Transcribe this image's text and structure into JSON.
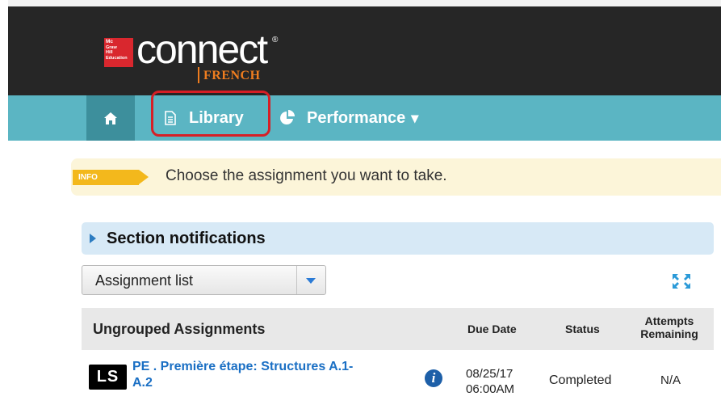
{
  "header": {
    "publisher_logo_lines": [
      "Mc",
      "Graw",
      "Hill",
      "Education"
    ],
    "brand": "connect",
    "brand_mark": "®",
    "subject": "FRENCH"
  },
  "nav": {
    "home_icon": "home-icon",
    "library_icon": "document-icon",
    "library_label": "Library",
    "performance_icon": "pie-chart-icon",
    "performance_label": "Performance",
    "performance_caret": "▾",
    "highlight_color": "#d61f26"
  },
  "info": {
    "badge": "INFO",
    "message": "Choose the assignment you want to take."
  },
  "notifications": {
    "title": "Section notifications"
  },
  "view_select": {
    "selected": "Assignment list"
  },
  "table": {
    "group_title": "Ungrouped Assignments",
    "columns": {
      "due": "Due Date",
      "status": "Status",
      "attempts_line1": "Attempts",
      "attempts_line2": "Remaining"
    },
    "rows": [
      {
        "badge": "LS",
        "title_line1": "PE . Première étape: Structures A.1-",
        "title_line2": "A.2",
        "due_date": "08/25/17",
        "due_time": "06:00AM",
        "status": "Completed",
        "attempts": "N/A"
      }
    ]
  },
  "colors": {
    "header_bg": "#262626",
    "nav_bg": "#5bb5c3",
    "nav_active_bg": "#3d8f9c",
    "accent_orange": "#ef7d1f",
    "link_blue": "#1a6fc4",
    "info_badge": "#f3b81c"
  }
}
